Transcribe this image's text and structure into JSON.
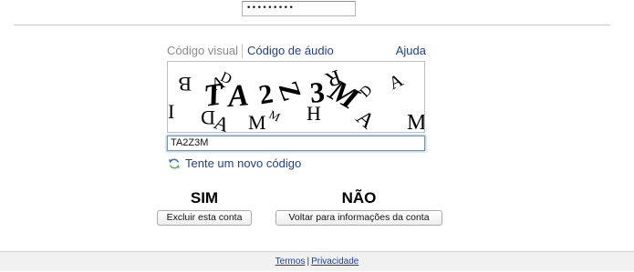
{
  "password_field": {
    "masked_value": "•••••••••"
  },
  "captcha": {
    "tab_visual": "Código visual",
    "tab_audio": "Código de áudio",
    "help_link": "Ajuda",
    "input_value": "TA2Z3M",
    "new_code_link": "Tente um novo código",
    "refresh_icon": "refresh-icon"
  },
  "options": {
    "yes_heading": "SIM",
    "no_heading": "NÃO",
    "delete_button": "Excluir esta conta",
    "back_button": "Voltar para informações da conta"
  },
  "footer": {
    "terms_link": "Termos",
    "separator": "|",
    "privacy_link": "Privacidade"
  },
  "colors": {
    "link": "#1a3da8",
    "muted_tab": "#8a8a8a",
    "focus_border": "#5b9dd9"
  }
}
